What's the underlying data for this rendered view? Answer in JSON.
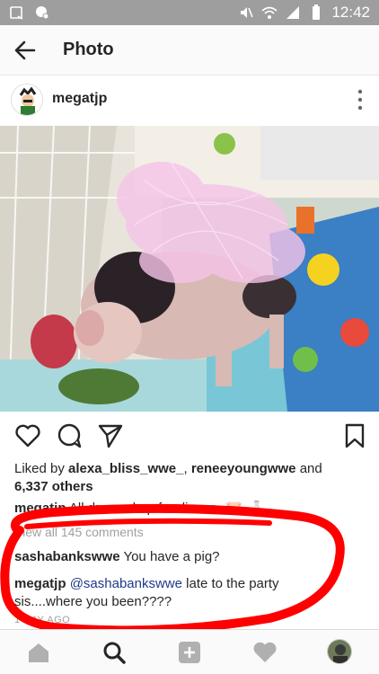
{
  "status_bar": {
    "time": "12:42"
  },
  "app_bar": {
    "title": "Photo"
  },
  "post": {
    "username": "megatjp",
    "likes_prefix": "Liked by ",
    "liker_1": "alexa_bliss_wwe_",
    "liker_sep": ", ",
    "liker_2": "reneeyoungwwe",
    "likes_and": " and",
    "likes_count": "6,337 others",
    "caption_user": "megatjp",
    "caption_text": " All dressed up for dinner.. 🐷 🍶",
    "view_comments": "View all 145 comments",
    "comments": [
      {
        "user": "sashabankswwe",
        "text": " You have a pig?"
      },
      {
        "user": "megatjp",
        "mention": "@sashabankswwe",
        "text": " late to the party sis....where you been????"
      }
    ],
    "time_ago": "1 DAY AGO"
  },
  "colors": {
    "annotation_red": "#ff0000",
    "link_blue": "#1e3a8a"
  }
}
